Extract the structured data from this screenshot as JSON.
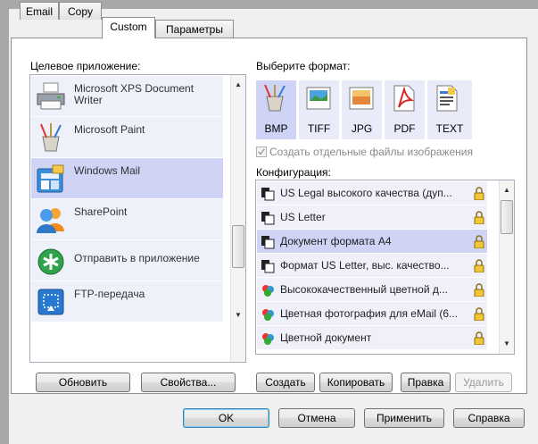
{
  "tabs": [
    "Email",
    "Copy",
    "Custom",
    "Параметры"
  ],
  "active_tab": "Custom",
  "left": {
    "label": "Целевое приложение:",
    "apps": [
      {
        "name": "Microsoft XPS Document Writer",
        "icon": "printer-icon"
      },
      {
        "name": "Microsoft Paint",
        "icon": "paint-brushes-icon"
      },
      {
        "name": "Windows Mail",
        "icon": "windows-mail-icon",
        "selected": true
      },
      {
        "name": "SharePoint",
        "icon": "sharepoint-people-icon"
      },
      {
        "name": "Отправить в приложение",
        "icon": "send-to-application-icon"
      },
      {
        "name": "FTP-передача",
        "icon": "ftp-transfer-icon"
      }
    ],
    "refresh_button": "Обновить",
    "properties_button": "Свойства..."
  },
  "right": {
    "format_label": "Выберите формат:",
    "formats": [
      {
        "name": "BMP",
        "icon": "bmp-icon",
        "selected": true
      },
      {
        "name": "TIFF",
        "icon": "tiff-icon"
      },
      {
        "name": "JPG",
        "icon": "jpg-icon"
      },
      {
        "name": "PDF",
        "icon": "pdf-icon"
      },
      {
        "name": "TEXT",
        "icon": "text-document-icon"
      }
    ],
    "separate_files_label": "Создать отдельные файлы изображения",
    "separate_files_checked": true,
    "config_label": "Конфигурация:",
    "configs": [
      {
        "name": "US Legal высокого качества (дуп...",
        "icon": "bw-document-icon"
      },
      {
        "name": "US Letter",
        "icon": "bw-document-icon"
      },
      {
        "name": "Документ формата А4",
        "icon": "bw-document-icon",
        "selected": true
      },
      {
        "name": "Формат US Letter, выс. качество...",
        "icon": "bw-document-icon"
      },
      {
        "name": "Высококачественный цветной д...",
        "icon": "color-document-icon"
      },
      {
        "name": "Цветная фотография для eMail (6...",
        "icon": "color-document-icon"
      },
      {
        "name": "Цветной документ",
        "icon": "color-document-icon"
      }
    ],
    "create_button": "Создать",
    "copy_button": "Копировать",
    "edit_button": "Правка",
    "delete_button": "Удалить"
  },
  "footer": {
    "ok": "OK",
    "cancel": "Отмена",
    "apply": "Применить",
    "help": "Справка"
  }
}
